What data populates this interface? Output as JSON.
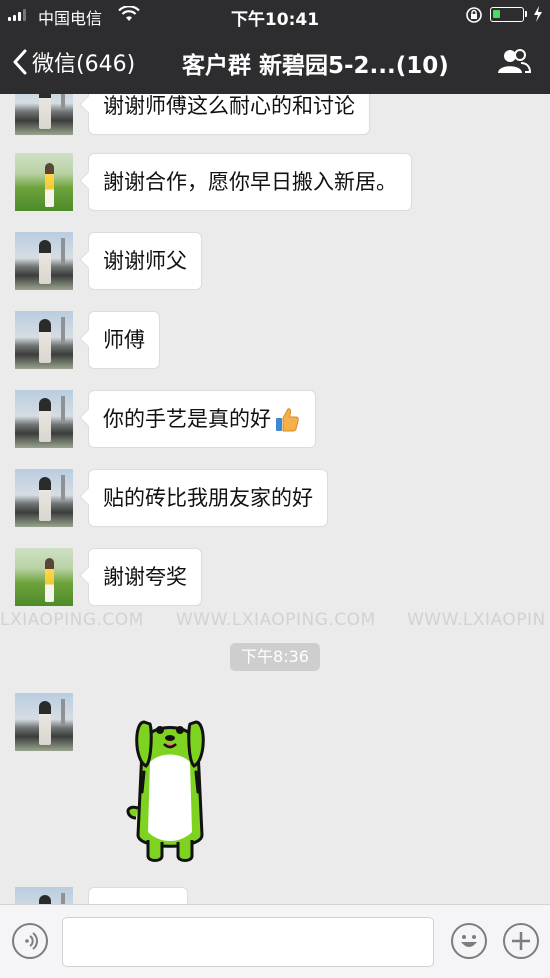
{
  "status_bar": {
    "carrier": "中国电信",
    "time": "下午10:41"
  },
  "nav": {
    "back_label": "微信(646)",
    "title": "客户群 新碧园5-2...(10)"
  },
  "messages": [
    {
      "text": "谢谢师傅这么耐心的和讨论",
      "avatar": "a"
    },
    {
      "text": "謝谢合作，愿你早日搬入新居。",
      "avatar": "b"
    },
    {
      "text": "谢谢师父",
      "avatar": "a"
    },
    {
      "text": "师傅",
      "avatar": "a"
    },
    {
      "text": "你的手艺是真的好",
      "avatar": "a",
      "emoji": "thumbs-up-icon"
    },
    {
      "text": "贴的砖比我朋友家的好",
      "avatar": "a"
    },
    {
      "text": "謝谢夸奖",
      "avatar": "b"
    }
  ],
  "watermark": {
    "segments": [
      "LXIAOPING.COM",
      "WWW.LXIAOPING.COM",
      "WWW.LXIAOPIN"
    ]
  },
  "timestamp": "下午8:36",
  "input": {
    "value": "",
    "placeholder": ""
  },
  "colors": {
    "nav_bg": "#2d2d2f",
    "chat_bg": "#ebebeb",
    "battery_level": "#4cd964",
    "sticker_green": "#7ed321"
  },
  "battery_fraction": 0.25
}
